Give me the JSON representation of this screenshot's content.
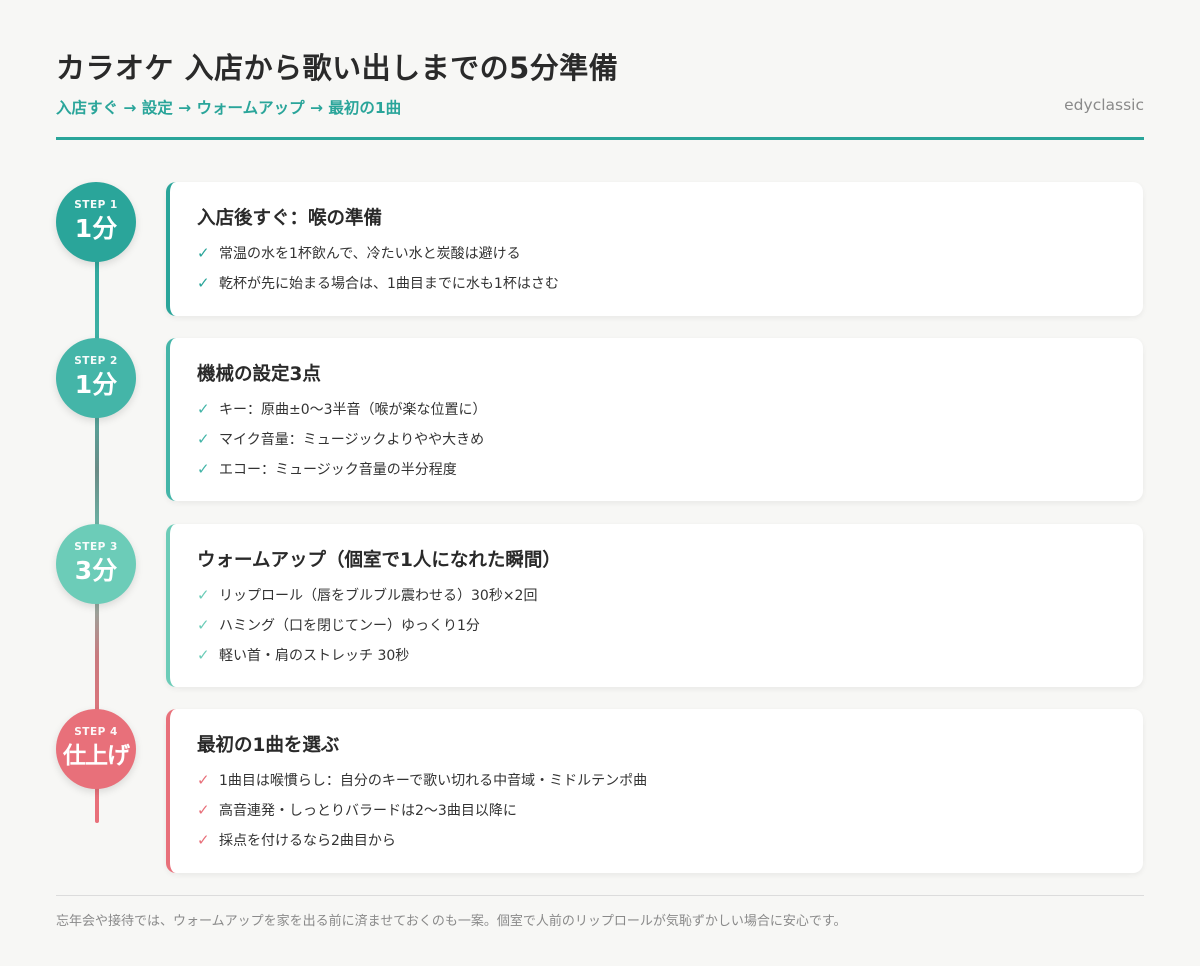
{
  "header": {
    "title": "カラオケ 入店から歌い出しまでの5分準備",
    "subtitle": "入店すぐ → 設定 → ウォームアップ → 最初の1曲",
    "brand": "edyclassic"
  },
  "colors": {
    "accent": "#2aa59a",
    "step1": "#2aa59a",
    "step2": "#44b5a8",
    "step3": "#6cccb8",
    "step4": "#e8707a"
  },
  "check_mark": "✓",
  "steps": [
    {
      "step_label": "STEP 1",
      "time": "1分",
      "title": "入店後すぐ：喉の準備",
      "items": [
        "常温の水を1杯飲んで、冷たい水と炭酸は避ける",
        "乾杯が先に始まる場合は、1曲目までに水も1杯はさむ"
      ]
    },
    {
      "step_label": "STEP 2",
      "time": "1分",
      "title": "機械の設定3点",
      "items": [
        "キー：原曲±0〜3半音（喉が楽な位置に）",
        "マイク音量：ミュージックよりやや大きめ",
        "エコー：ミュージック音量の半分程度"
      ]
    },
    {
      "step_label": "STEP 3",
      "time": "3分",
      "title": "ウォームアップ（個室で1人になれた瞬間）",
      "items": [
        "リップロール（唇をブルブル震わせる）30秒×2回",
        "ハミング（口を閉じてンー）ゆっくり1分",
        "軽い首・肩のストレッチ 30秒"
      ]
    },
    {
      "step_label": "STEP 4",
      "time": "仕上げ",
      "title": "最初の1曲を選ぶ",
      "items": [
        "1曲目は喉慣らし：自分のキーで歌い切れる中音域・ミドルテンポ曲",
        "高音連発・しっとりバラードは2〜3曲目以降に",
        "採点を付けるなら2曲目から"
      ]
    }
  ],
  "footer": "忘年会や接待では、ウォームアップを家を出る前に済ませておくのも一案。個室で人前のリップロールが気恥ずかしい場合に安心です。"
}
